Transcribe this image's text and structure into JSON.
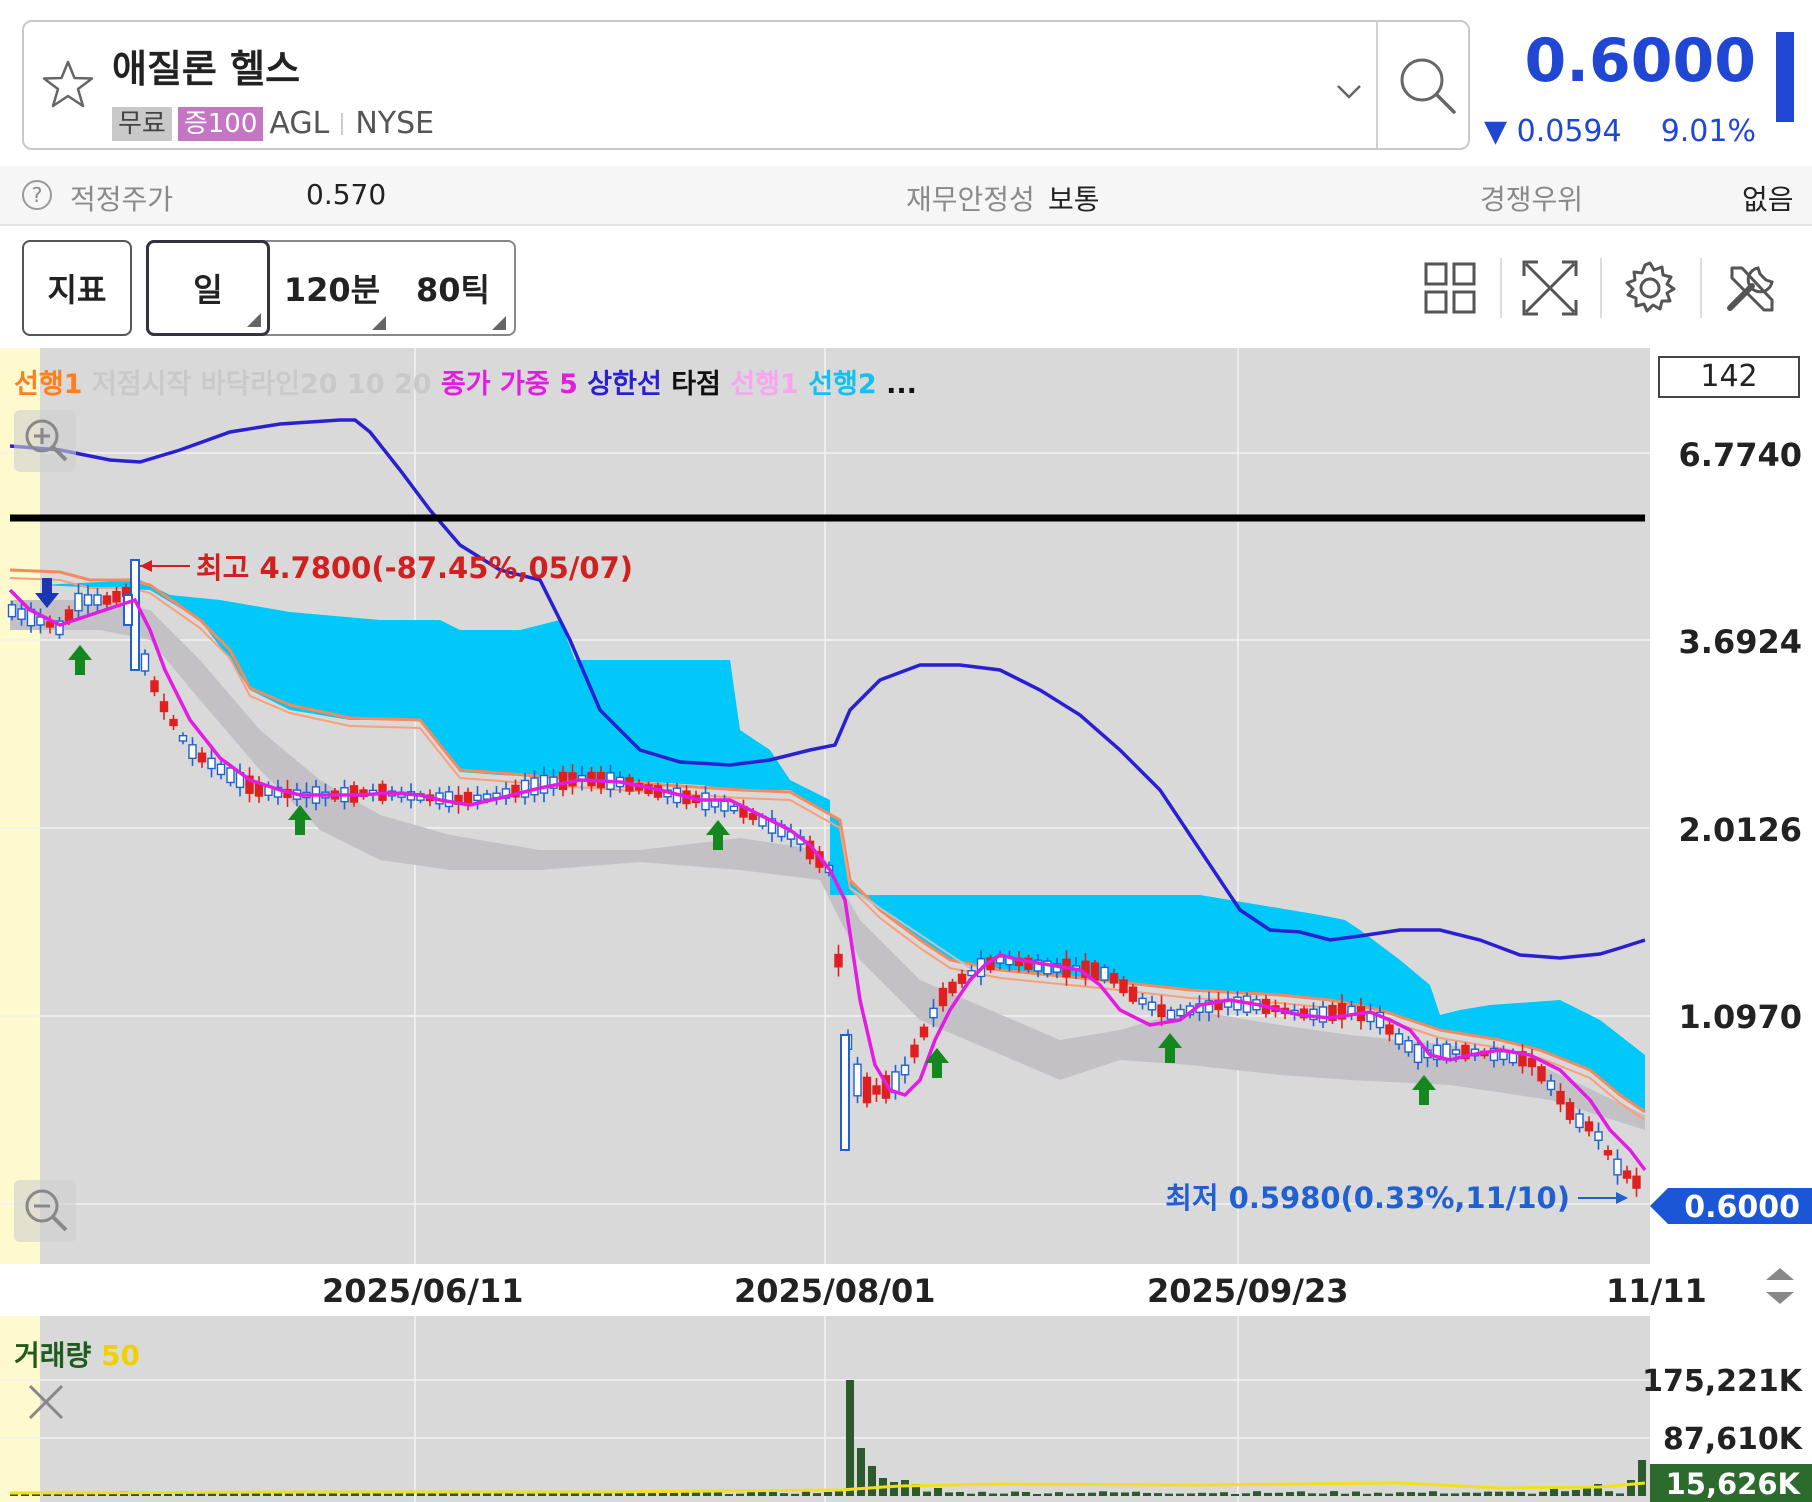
{
  "header": {
    "stock_name": "애질론 헬스",
    "tags": {
      "free": "무료",
      "margin": "증100",
      "ticker": "AGL",
      "exchange": "NYSE"
    },
    "price": "0.6000",
    "change": "0.0594",
    "change_pct": "9.01%"
  },
  "info": {
    "fair_price_label": "적정주가",
    "fair_price_value": "0.570",
    "stability_label": "재무안정성",
    "stability_value": "보통",
    "competitive_label": "경쟁우위",
    "competitive_value": "없음"
  },
  "toolbar": {
    "indicator_btn": "지표",
    "tabs": [
      "일",
      "120분",
      "80틱"
    ]
  },
  "chart": {
    "legend": [
      {
        "text": "선행1",
        "color": "#ff7f1e"
      },
      {
        "text": "저점시작 바닥라인20 10 20",
        "color": "#c9c9c9"
      },
      {
        "text": "종가 가중 5",
        "color": "#e31ce3"
      },
      {
        "text": "상한선",
        "color": "#2a1fd1"
      },
      {
        "text": "타점",
        "color": "#111111"
      },
      {
        "text": "선행1",
        "color": "#f6a6f0"
      },
      {
        "text": "선행2",
        "color": "#16bff0"
      },
      {
        "text": "...",
        "color": "#111111"
      }
    ],
    "visible_count": "142",
    "y_labels": [
      "6.7740",
      "3.6924",
      "2.0126",
      "1.0970"
    ],
    "current_price_tag": "0.6000",
    "x_labels": [
      "2025/06/11",
      "2025/08/01",
      "2025/09/23",
      "11/11"
    ],
    "high_annotation": "최고 4.7800(-87.45%,05/07)",
    "low_annotation": "최저 0.5980(0.33%,11/10)",
    "colors": {
      "up": "#e02020",
      "down": "#2060d0",
      "cloud": "#00c8f8",
      "band": "#c3c1c6",
      "upper": "#2a1fd1",
      "ma": "#e31ce3"
    }
  },
  "volume": {
    "label": "거래량",
    "period": "50",
    "y_labels": [
      "175,221K",
      "87,610K"
    ],
    "current_tag": "15,626K"
  },
  "chart_data": {
    "type": "candlestick",
    "y_axis": "log",
    "high": {
      "value": 4.78,
      "date": "05/07"
    },
    "low": {
      "value": 0.598,
      "date": "11/10"
    },
    "last": 0.6,
    "volume_axis": [
      "175,221K",
      "87,610K"
    ],
    "volume_last": "15,626K"
  }
}
